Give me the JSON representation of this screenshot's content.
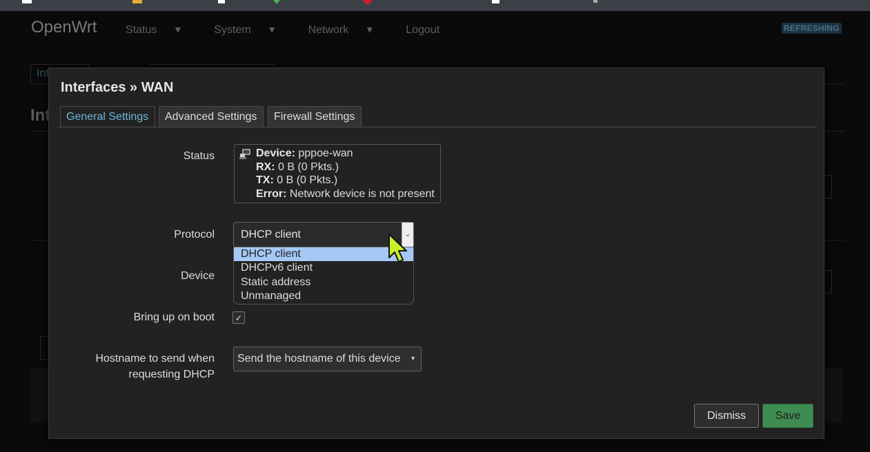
{
  "bookmarks_bar": {
    "icons": [
      "bookmark-icon",
      "bookmark-icon",
      "bookmark-icon",
      "bookmark-icon",
      "bookmark-icon",
      "bookmark-icon",
      "bookmark-icon"
    ]
  },
  "background": {
    "brand": "OpenWrt",
    "nav": [
      "Status",
      "System",
      "Network",
      "Logout"
    ],
    "refreshing": "REFRESHING",
    "tab_fragment": "Int",
    "heading_fragment": "Int"
  },
  "modal": {
    "title": "Interfaces » WAN",
    "tabs": [
      "General Settings",
      "Advanced Settings",
      "Firewall Settings"
    ],
    "fields": {
      "status_label": "Status",
      "protocol_label": "Protocol",
      "device_label": "Device",
      "boot_label": "Bring up on boot",
      "hostname_label_1": "Hostname to send when",
      "hostname_label_2": "requesting DHCP"
    },
    "status": {
      "device_key": "Device:",
      "device_val": "pppoe-wan",
      "rx_key": "RX:",
      "rx_val": "0 B (0 Pkts.)",
      "tx_key": "TX:",
      "tx_val": "0 B (0 Pkts.)",
      "error_key": "Error:",
      "error_val": "Network device is not present"
    },
    "protocol": {
      "selected": "DHCP client",
      "options": [
        "DHCP client",
        "DHCPv6 client",
        "Static address",
        "Unmanaged"
      ]
    },
    "hostname": {
      "selected": "Send the hostname of this device"
    },
    "buttons": {
      "dismiss": "Dismiss",
      "save": "Save"
    },
    "colors": {
      "active_tab": "#6fb6dd",
      "save_bg": "#3f8c52",
      "selected_option": "#a5c8f5"
    }
  }
}
